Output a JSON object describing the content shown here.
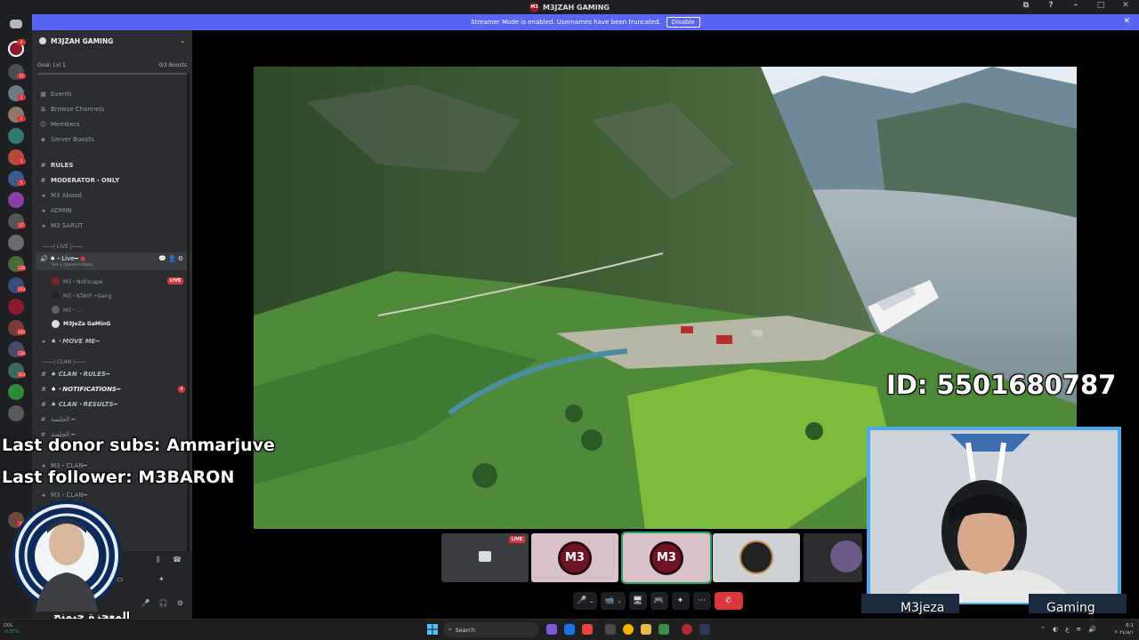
{
  "window": {
    "title": "M3JZAH GAMING",
    "controls": [
      "⧉",
      "?",
      "–",
      "□",
      "✕"
    ]
  },
  "banner": {
    "text": "Streamer Mode is enabled. Usernames have been truncated.",
    "button": "Disable"
  },
  "rail": {
    "badges": [
      "4",
      "15",
      "2",
      "1",
      "5",
      "5",
      "27",
      "129",
      "293",
      "220",
      "128",
      "163",
      "74"
    ]
  },
  "server": {
    "name": "M3JZAH GAMING",
    "goal_label": "Goal: Lvl 1",
    "goal_boosts": "0/2 Boosts",
    "goal_progress": 0,
    "menu": [
      {
        "label": "Events",
        "icon": "calendar-icon"
      },
      {
        "label": "Browse Channels",
        "icon": "browse-icon"
      },
      {
        "label": "Members",
        "icon": "members-icon"
      },
      {
        "label": "Server Boosts",
        "icon": "boost-icon"
      }
    ],
    "channels_top": [
      {
        "label": "RULES",
        "icon": "text-channel-icon"
      },
      {
        "label": "MODERATOR・ONLY",
        "icon": "text-channel-icon"
      },
      {
        "label": "M3 Abood",
        "icon": "voice-channel-icon"
      },
      {
        "label": "ADMIN",
        "icon": "voice-channel-icon"
      },
      {
        "label": "M3 SARUT",
        "icon": "voice-channel-icon"
      }
    ],
    "cat_live": "——| LIVE |——",
    "live_channel": {
      "name": "♠・Live━",
      "status": "Set a channel status"
    },
    "voice_users": [
      {
        "label": "M3・NoEscape"
      },
      {
        "label": "M3・KTAYF ⚡Gang"
      },
      {
        "label": "M3・…"
      },
      {
        "label": "M3JeZa GaMinG"
      }
    ],
    "live_badge": "LIVE",
    "move_me": "♠・MOVE ME━",
    "cat_clan": "——| CLAN |——",
    "clan_channels": [
      {
        "label": "♠ CLAN・RULES━"
      },
      {
        "label": "♠・NOTIFICATIONS━"
      },
      {
        "label": "♠ CLAN・RESULTS━"
      },
      {
        "label": "ا‌لجلسة‌ ━"
      },
      {
        "label": "ا‌لجلسة‌ ━"
      }
    ],
    "mention_count": "4",
    "clan_voice": [
      {
        "label": "M3・CLAN━"
      },
      {
        "label": "M3・CLAN━"
      }
    ]
  },
  "tiles": {
    "live": "LIVE",
    "m3": "M3"
  },
  "controls": {
    "mic": "🎤",
    "camera": "📹",
    "screen": "🖥",
    "activity": "🎮",
    "soundboard": "✦",
    "more": "···",
    "hangup": "✆"
  },
  "overlay": {
    "donor": "Last donor subs: Ammarjuve",
    "follower": "Last follower: M3BARON",
    "id": "ID: 5501680787",
    "cam_left": "M3jeza",
    "cam_right": "Gaming",
    "arabic": "المعجزة جيمنج"
  },
  "taskbar": {
    "stock_name": "DOL",
    "stock_change": "-0.97%",
    "search_placeholder": "Search",
    "time": "6:1",
    "date": "٢٠٢٤/٨/١"
  },
  "colors": {
    "accent": "#5865f2",
    "danger": "#da373c",
    "online": "#23a55a",
    "brand": "#6e1424"
  }
}
